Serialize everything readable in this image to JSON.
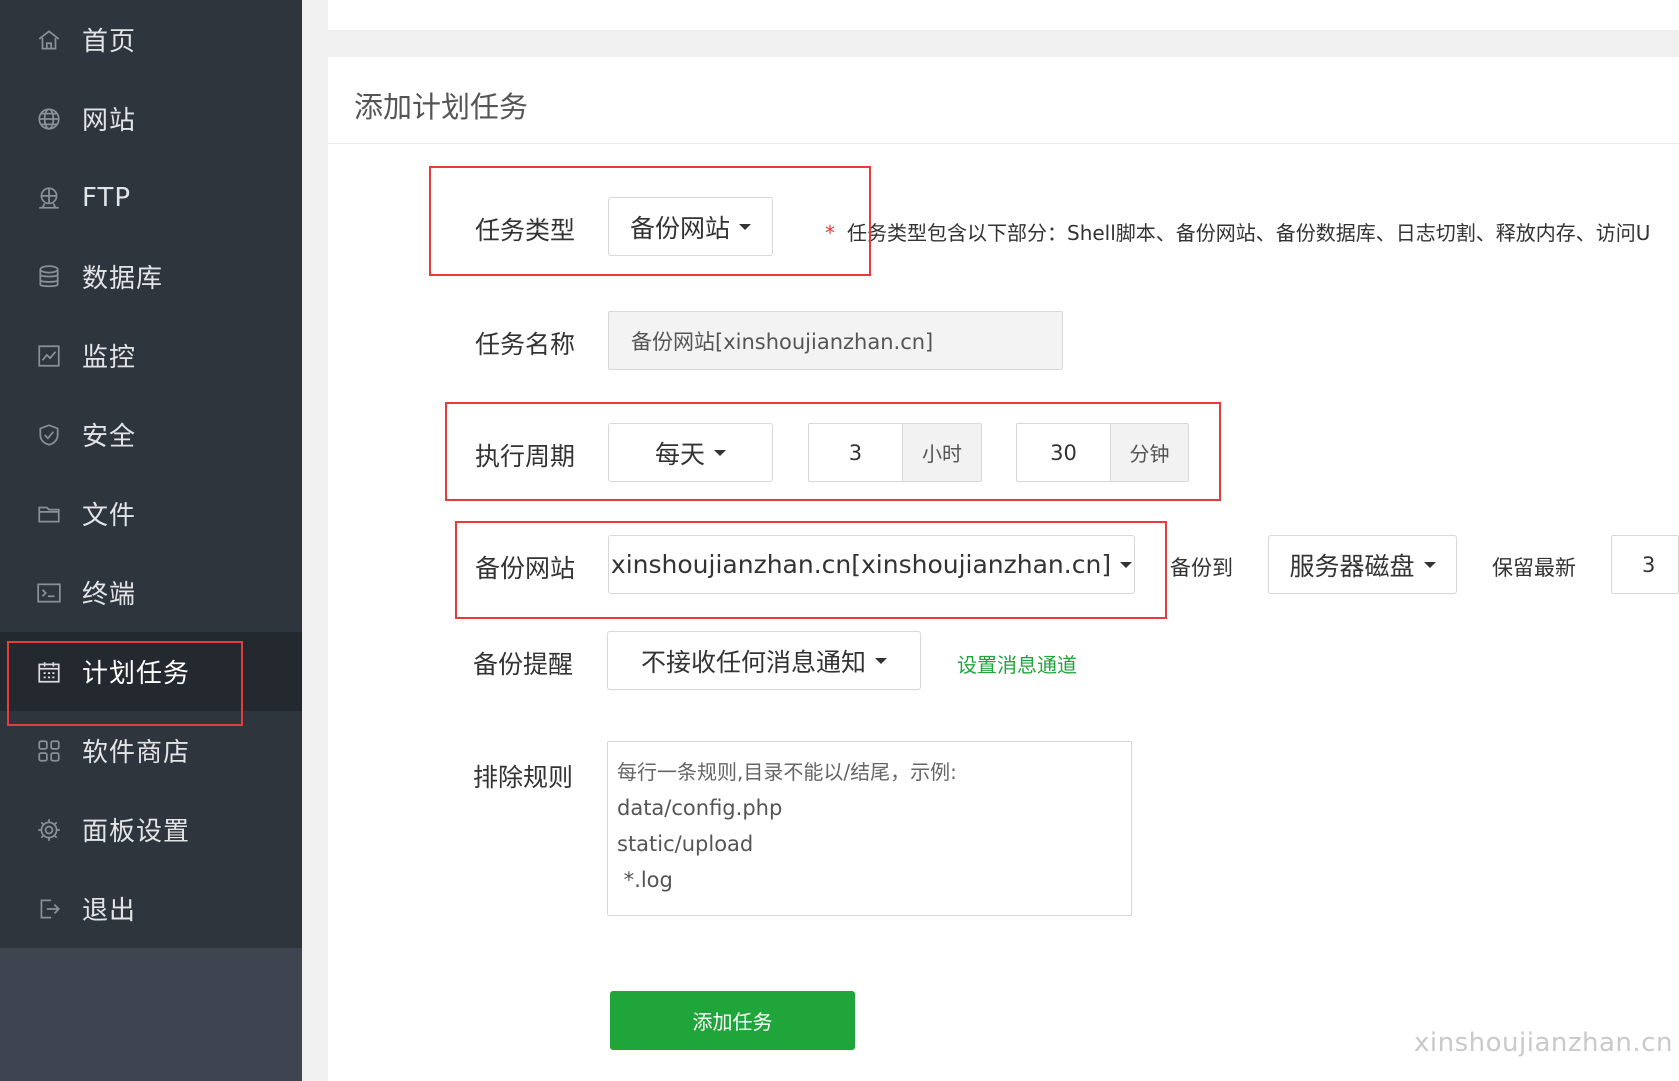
{
  "sidebar": {
    "items": [
      {
        "label": "首页",
        "icon": "home-icon"
      },
      {
        "label": "网站",
        "icon": "globe-icon"
      },
      {
        "label": "FTP",
        "icon": "ftp-icon"
      },
      {
        "label": "数据库",
        "icon": "database-icon"
      },
      {
        "label": "监控",
        "icon": "monitor-icon"
      },
      {
        "label": "安全",
        "icon": "shield-icon"
      },
      {
        "label": "文件",
        "icon": "folder-icon"
      },
      {
        "label": "终端",
        "icon": "terminal-icon"
      },
      {
        "label": "计划任务",
        "icon": "calendar-icon",
        "active": true
      },
      {
        "label": "软件商店",
        "icon": "grid-icon"
      },
      {
        "label": "面板设置",
        "icon": "gear-icon"
      },
      {
        "label": "退出",
        "icon": "logout-icon"
      }
    ]
  },
  "form": {
    "title": "添加计划任务",
    "task_type": {
      "label": "任务类型",
      "value": "备份网站",
      "hint_star": "*",
      "hint": "任务类型包含以下部分：Shell脚本、备份网站、备份数据库、日志切割、释放内存、访问U"
    },
    "task_name": {
      "label": "任务名称",
      "value": "备份网站[xinshoujianzhan.cn]"
    },
    "period": {
      "label": "执行周期",
      "value": "每天",
      "hour": "3",
      "hour_unit": "小时",
      "minute": "30",
      "minute_unit": "分钟"
    },
    "backup_site": {
      "label": "备份网站",
      "value": "xinshoujianzhan.cn[xinshoujianzhan.cn]",
      "backup_to_label": "备份到",
      "backup_to_value": "服务器磁盘",
      "keep_label": "保留最新",
      "keep_value": "3"
    },
    "notify": {
      "label": "备份提醒",
      "value": "不接收任何消息通知",
      "link": "设置消息通道"
    },
    "exclude": {
      "label": "排除规则",
      "placeholder_lines": [
        "每行一条规则,目录不能以/结尾，示例:",
        "data/config.php",
        "static/upload",
        " *.log"
      ]
    },
    "submit_label": "添加任务"
  },
  "watermark": "xinshoujianzhan.cn",
  "colors": {
    "accent": "#20a53a",
    "highlight": "#e53c3c",
    "sidebar_bg": "#2f353d"
  }
}
